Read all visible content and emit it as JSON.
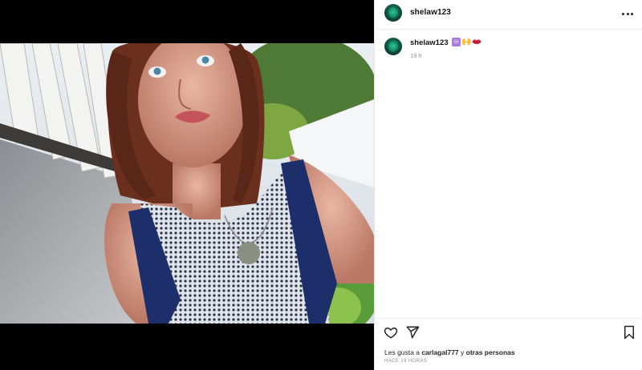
{
  "post": {
    "username": "shelaw123",
    "more_icon": "more-horizontal-icon"
  },
  "caption": {
    "username": "shelaw123",
    "emojis": [
      "infinity-emoji",
      "raised-hands-emoji",
      "kiss-mark-emoji"
    ],
    "infinity_symbol": "♾",
    "hands_symbol": "🙌",
    "timestamp": "19 h"
  },
  "actions": {
    "like_icon": "heart-icon",
    "share_icon": "paper-plane-icon",
    "save_icon": "bookmark-icon"
  },
  "likes": {
    "prefix": "Les gusta a",
    "first_liker": "carlagal777",
    "joiner": "y",
    "others": "otras personas"
  },
  "date_label": "HACE 19 HORAS",
  "colors": {
    "avatar": "#138a66",
    "muted": "#8e8e8e",
    "divider": "#efefef",
    "media_background": "#000000"
  }
}
